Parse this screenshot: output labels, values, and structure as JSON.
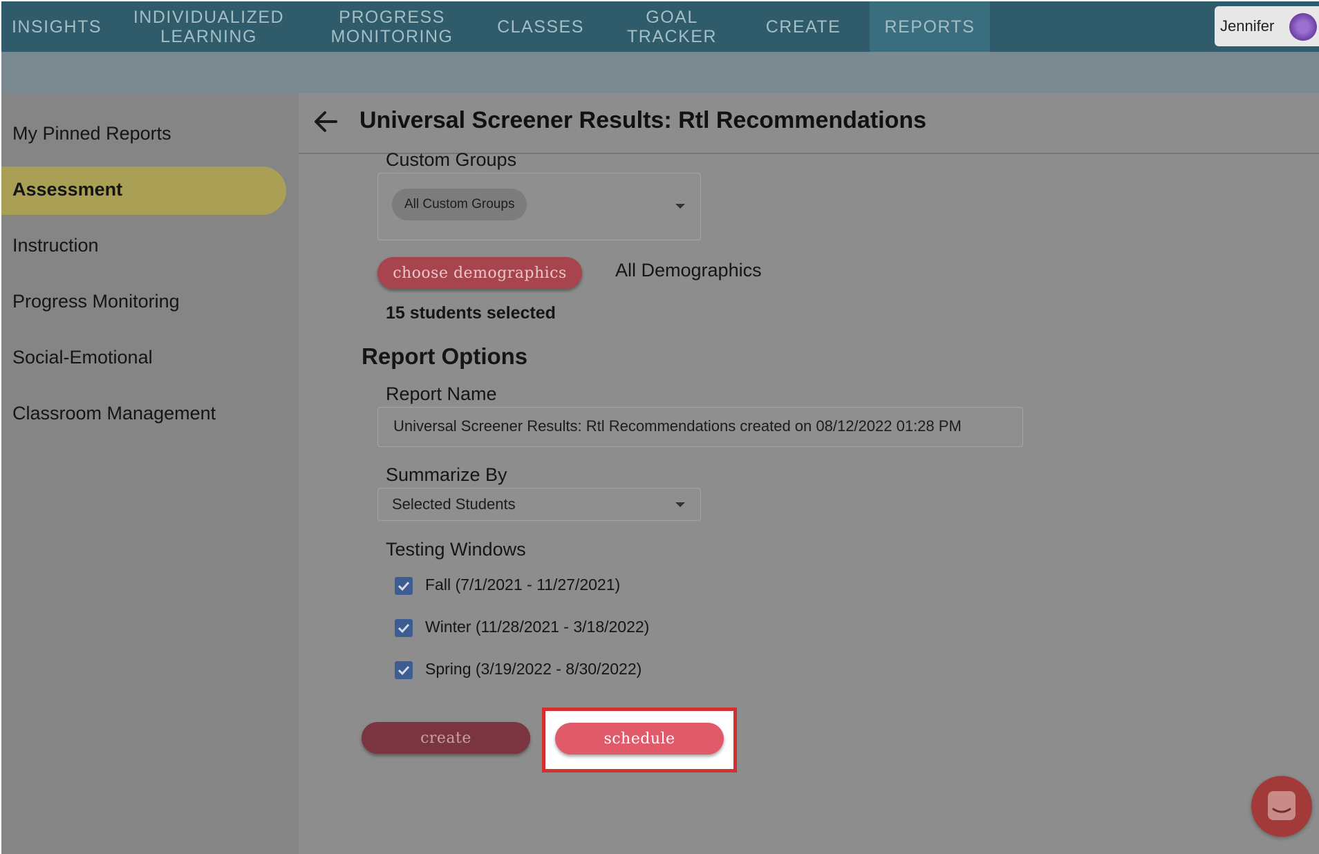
{
  "nav": {
    "items": [
      {
        "label": "INSIGHTS"
      },
      {
        "label": "INDIVIDUALIZED\nLEARNING"
      },
      {
        "label": "PROGRESS\nMONITORING"
      },
      {
        "label": "CLASSES"
      },
      {
        "label": "GOAL TRACKER"
      },
      {
        "label": "CREATE"
      },
      {
        "label": "REPORTS"
      }
    ],
    "active": "REPORTS",
    "user_name": "Jennifer"
  },
  "sidebar": {
    "items": [
      {
        "label": "My Pinned Reports"
      },
      {
        "label": "Assessment"
      },
      {
        "label": "Instruction"
      },
      {
        "label": "Progress Monitoring"
      },
      {
        "label": "Social-Emotional"
      },
      {
        "label": "Classroom Management"
      }
    ],
    "active": "Assessment"
  },
  "header": {
    "title": "Universal Screener Results: Rtl Recommendations"
  },
  "custom_groups": {
    "label": "Custom Groups",
    "chip": "All Custom Groups"
  },
  "demographics": {
    "button": "choose demographics",
    "value": "All Demographics"
  },
  "selection": {
    "count_text": "15 students selected"
  },
  "report_options": {
    "heading": "Report Options",
    "report_name_label": "Report Name",
    "report_name_value": "Universal Screener Results: Rtl Recommendations created on 08/12/2022 01:28 PM",
    "summarize_label": "Summarize By",
    "summarize_value": "Selected Students",
    "testing_windows_label": "Testing Windows",
    "testing_windows": [
      {
        "label": "Fall (7/1/2021 - 11/27/2021)",
        "checked": true
      },
      {
        "label": "Winter (11/28/2021 - 3/18/2022)",
        "checked": true
      },
      {
        "label": "Spring (3/19/2022 - 8/30/2022)",
        "checked": true
      }
    ]
  },
  "actions": {
    "create": "create",
    "schedule": "schedule"
  },
  "colors": {
    "nav_bg": "#2f5b6a",
    "active_side": "#a9a055",
    "button": "#e05a6a",
    "highlight": "#d32f2f"
  }
}
